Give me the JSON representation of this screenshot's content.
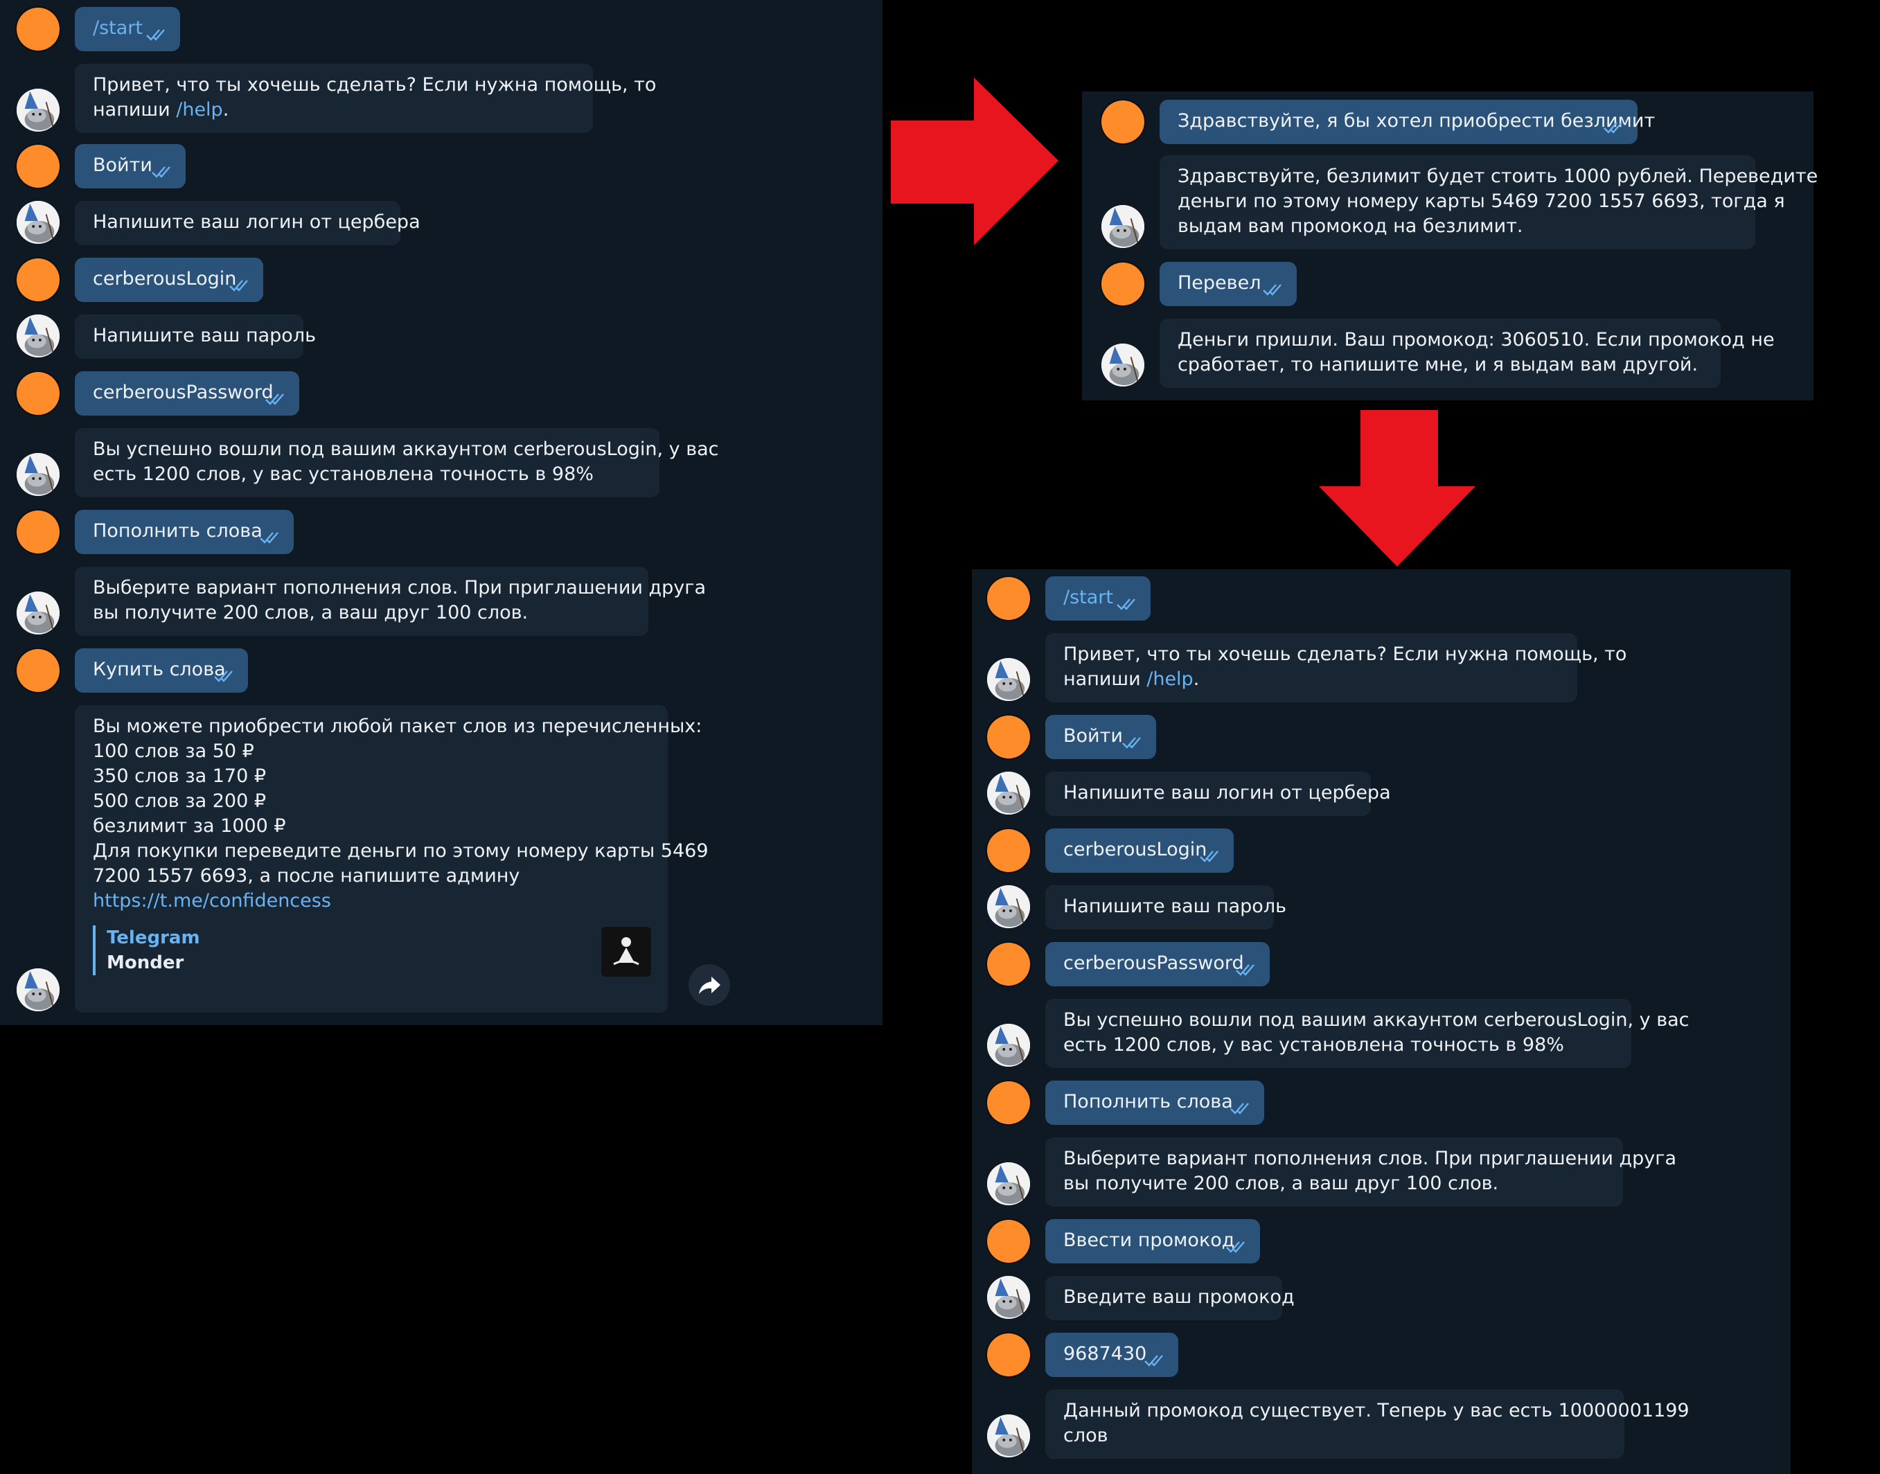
{
  "colors": {
    "background": "#000000",
    "chat_bg": "#0f1923",
    "outgoing_bubble": "#2b5278",
    "incoming_bubble": "#182533",
    "link": "#6ab3f3",
    "user_avatar": "#ff8c2a",
    "arrow": "#e8141e"
  },
  "left_chat": {
    "messages": [
      {
        "from": "user",
        "text": "/start",
        "is_command": true
      },
      {
        "from": "bot",
        "lines": [
          "Привет, что ты хочешь сделать? Если нужна помощь, то"
        ],
        "line2_prefix": "напиши ",
        "line2_link": "/help",
        "line2_suffix": "."
      },
      {
        "from": "user",
        "text": "Войти"
      },
      {
        "from": "bot",
        "lines": [
          "Напишите ваш логин от цербера"
        ]
      },
      {
        "from": "user",
        "text": "cerberousLogin"
      },
      {
        "from": "bot",
        "lines": [
          "Напишите ваш пароль"
        ]
      },
      {
        "from": "user",
        "text": "cerberousPassword"
      },
      {
        "from": "bot",
        "lines": [
          "Вы успешно вошли под вашим аккаунтом cerberousLogin, у вас",
          "есть 1200 слов, у вас установлена точность в 98%"
        ]
      },
      {
        "from": "user",
        "text": "Пополнить слова"
      },
      {
        "from": "bot",
        "lines": [
          "Выберите вариант пополнения слов. При приглашении друга",
          "вы получите 200 слов, а ваш друг 100 слов."
        ]
      },
      {
        "from": "user",
        "text": "Купить слова"
      },
      {
        "from": "bot",
        "lines": [
          "Вы можете приобрести любой пакет слов из перечисленных:",
          "100 слов за 50 ₽",
          "350 слов за 170 ₽",
          "500 слов за 200 ₽",
          "безлимит за 1000 ₽",
          "Для покупки переведите деньги по этому номеру карты 5469",
          "7200 1557 6693, а после напишите админу"
        ],
        "link": "https://t.me/confidencess",
        "preview_title": "Telegram",
        "preview_subtitle": "Monder"
      }
    ],
    "thumb_icon": "meditating-figure-icon",
    "forward_icon": "share-arrow-icon"
  },
  "top_right_chat": {
    "messages": [
      {
        "from": "user",
        "text": "Здравствуйте, я бы хотел приобрести безлимит"
      },
      {
        "from": "bot",
        "lines": [
          "Здравствуйте, безлимит будет стоить 1000 рублей. Переведите",
          "деньги по этому номеру карты 5469 7200 1557 6693, тогда я",
          "выдам вам промокод на безлимит."
        ]
      },
      {
        "from": "user",
        "text": "Перевел"
      },
      {
        "from": "bot",
        "lines": [
          "Деньги пришли. Ваш промокод: 3060510. Если промокод не",
          "сработает, то напишите мне, и я выдам вам другой."
        ]
      }
    ]
  },
  "bottom_right_chat": {
    "messages": [
      {
        "from": "user",
        "text": "/start",
        "is_command": true
      },
      {
        "from": "bot",
        "lines": [
          "Привет, что ты хочешь сделать? Если нужна помощь, то"
        ],
        "line2_prefix": "напиши ",
        "line2_link": "/help",
        "line2_suffix": "."
      },
      {
        "from": "user",
        "text": "Войти"
      },
      {
        "from": "bot",
        "lines": [
          "Напишите ваш логин от цербера"
        ]
      },
      {
        "from": "user",
        "text": "cerberousLogin"
      },
      {
        "from": "bot",
        "lines": [
          "Напишите ваш пароль"
        ]
      },
      {
        "from": "user",
        "text": "cerberousPassword"
      },
      {
        "from": "bot",
        "lines": [
          "Вы успешно вошли под вашим аккаунтом cerberousLogin, у вас",
          "есть 1200 слов, у вас установлена точность в 98%"
        ]
      },
      {
        "from": "user",
        "text": "Пополнить слова"
      },
      {
        "from": "bot",
        "lines": [
          "Выберите вариант пополнения слов. При приглашении друга",
          "вы получите 200 слов, а ваш друг 100 слов."
        ]
      },
      {
        "from": "user",
        "text": "Ввести промокод"
      },
      {
        "from": "bot",
        "lines": [
          "Введите ваш промокод"
        ]
      },
      {
        "from": "user",
        "text": "9687430"
      },
      {
        "from": "bot",
        "lines": [
          "Данный промокод существует. Теперь у вас есть 10000001199",
          "слов"
        ]
      }
    ]
  }
}
